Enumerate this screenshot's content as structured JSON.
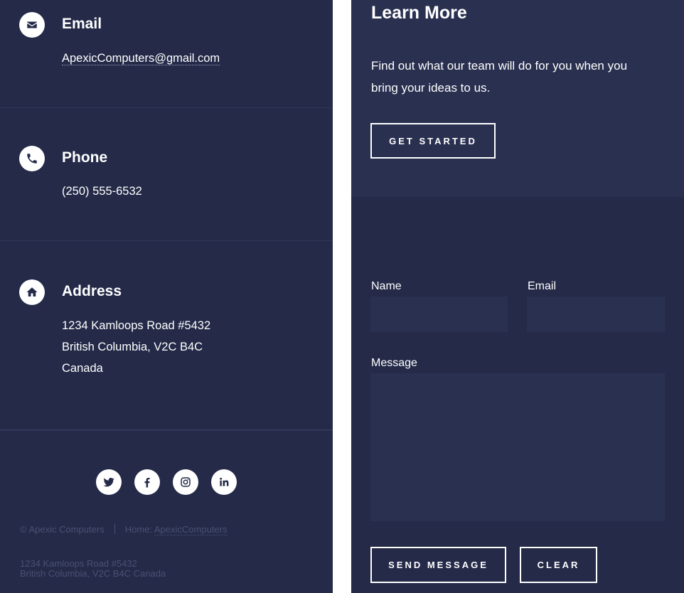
{
  "contact": {
    "email": {
      "title": "Email",
      "address": "ApexicComputers@gmail.com",
      "icon": "envelope-icon"
    },
    "phone": {
      "title": "Phone",
      "number": "(250) 555-6532",
      "icon": "phone-icon"
    },
    "address": {
      "title": "Address",
      "line1": "1234 Kamloops Road #5432",
      "line2": "British Columbia, V2C B4C",
      "line3": "Canada",
      "icon": "home-icon"
    }
  },
  "socials": [
    "twitter-icon",
    "facebook-icon",
    "instagram-icon",
    "linkedin-icon"
  ],
  "footer": {
    "copyright": "© Apexic Computers",
    "home_prefix": "Home:",
    "home_link": "ApexicComputers",
    "address_line1": "1234 Kamloops Road #5432",
    "address_line2": "British Columbia, V2C B4C Canada"
  },
  "learn_more": {
    "title": "Learn More",
    "description": "Find out what our team will do for you when you bring your ideas to us.",
    "button": "GET STARTED"
  },
  "form": {
    "name_label": "Name",
    "email_label": "Email",
    "message_label": "Message",
    "send_button": "SEND MESSAGE",
    "clear_button": "CLEAR"
  },
  "colors": {
    "panel_bg": "#242a48",
    "field_bg": "#2a3050",
    "text": "#ffffff",
    "muted": "#4a5073"
  }
}
